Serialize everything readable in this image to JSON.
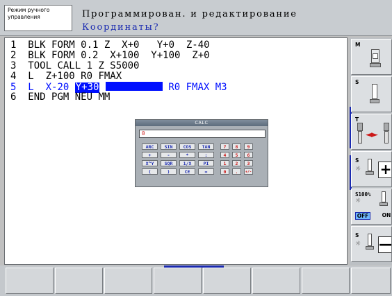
{
  "header": {
    "machine_mode_line1": "Режим ручного",
    "machine_mode_line2": "управления",
    "programming_mode": "Программирован. и редактирование",
    "dialog_prompt": "Координаты?"
  },
  "program": {
    "lines": [
      {
        "num": "1",
        "text": "BLK FORM 0.1 Z  X+0   Y+0  Z-40"
      },
      {
        "num": "2",
        "text": "BLK FORM 0.2  X+100  Y+100  Z+0"
      },
      {
        "num": "3",
        "text": "TOOL CALL 1 Z S5000"
      },
      {
        "num": "4",
        "text": "L  Z+100 R0 FMAX"
      },
      {
        "num": "5",
        "pre": "L  X-20 ",
        "selected": "Y+30",
        "post": " R0 FMAX M3",
        "active": true
      },
      {
        "num": "6",
        "text": "END PGM NEU MM"
      }
    ]
  },
  "calculator": {
    "title": "CALC",
    "display": "0",
    "rows": [
      {
        "fn": [
          "ARC",
          "SIN",
          "COS",
          "TAN"
        ],
        "digits": [
          "7",
          "8",
          "9"
        ]
      },
      {
        "fn": [
          "+",
          "-",
          "*",
          ":"
        ],
        "digits": [
          "4",
          "5",
          "6"
        ]
      },
      {
        "fn": [
          "X^Y",
          "SQR",
          "1/X",
          "PI"
        ],
        "digits": [
          "1",
          "2",
          "3"
        ]
      },
      {
        "fn": [
          "(",
          ")",
          "CE",
          "="
        ],
        "digits": [
          "0",
          ".",
          "+/-"
        ]
      }
    ]
  },
  "side_softkeys": {
    "m_label": "M",
    "s_label": "S",
    "t_label": "T",
    "s_plus_label": "S",
    "override_label": "S100%",
    "off_label": "OFF",
    "on_label": "ON",
    "s_minus_label": "S",
    "plus_symbol": "+",
    "minus_symbol": "—"
  },
  "colors": {
    "accent_blue": "#0010ff",
    "prompt_blue": "#1a2ab0",
    "calc_red": "#cc1a1a"
  }
}
